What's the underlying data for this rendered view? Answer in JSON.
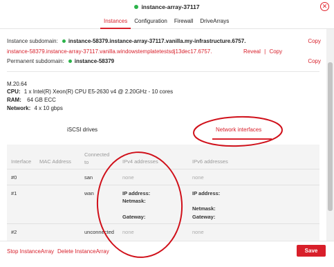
{
  "header": {
    "title": "instance-array-37117",
    "close_icon": "close-circle-icon",
    "tabs": [
      "Instances",
      "Configuration",
      "Firewall",
      "DriveArrays"
    ],
    "active_tab": "Instances"
  },
  "subdomains": {
    "instance_label": "Instance subdomain:",
    "instance_value": "instance-58379.instance-array-37117.vanilla.my-infrastructure.6757.",
    "instance_copy": "Copy",
    "windows_value": "instance-58379.instance-array-37117.vanilla.windowstemplatetestsdj13dec17.6757.",
    "reveal": "Reveal",
    "separator": "|",
    "windows_copy": "Copy",
    "permanent_label": "Permanent subdomain:",
    "permanent_value": "instance-58379",
    "permanent_copy": "Copy"
  },
  "specs": {
    "model": "M.20.64",
    "cpu_label": "CPU:",
    "cpu_value": "1 x Intel(R) Xeon(R) CPU E5-2630 v4 @ 2.20GHz - 10 cores",
    "ram_label": "RAM:",
    "ram_value": "64 GB ECC",
    "network_label": "Network:",
    "network_value": "4 x 10 gbps"
  },
  "subtabs": {
    "iscsi": "iSCSI drives",
    "network": "Network interfaces",
    "active": "Network interfaces"
  },
  "interfaces_table": {
    "headers": {
      "interface": "Interface",
      "mac": "MAC Address",
      "connected_line1": "Connected",
      "connected_line2": "to",
      "ipv4": "IPv4 addresses",
      "ipv6": "IPv6 addresses"
    },
    "rows": [
      {
        "interface": "#0",
        "mac": "",
        "connected": "san",
        "ipv4": "none",
        "ipv6": "none"
      },
      {
        "interface": "#1",
        "mac": "",
        "connected": "wan",
        "ipv4_ip_label": "IP address:",
        "ipv4_netmask_label": "Netmask:",
        "ipv4_gateway_label": "Gateway:",
        "ipv6_ip_label": "IP address:",
        "ipv6_netmask_label": "Netmask:",
        "ipv6_gateway_label": "Gateway:"
      },
      {
        "interface": "#2",
        "mac": "",
        "connected": "unconnected",
        "ipv4": "none",
        "ipv6": "none"
      }
    ]
  },
  "footer": {
    "stop": "Stop InstanceArray",
    "delete": "Delete InstanceArray",
    "save": "Save"
  },
  "colors": {
    "accent": "#d81f2a",
    "status_green": "#2bb34a",
    "annotation": "#d0101a"
  }
}
